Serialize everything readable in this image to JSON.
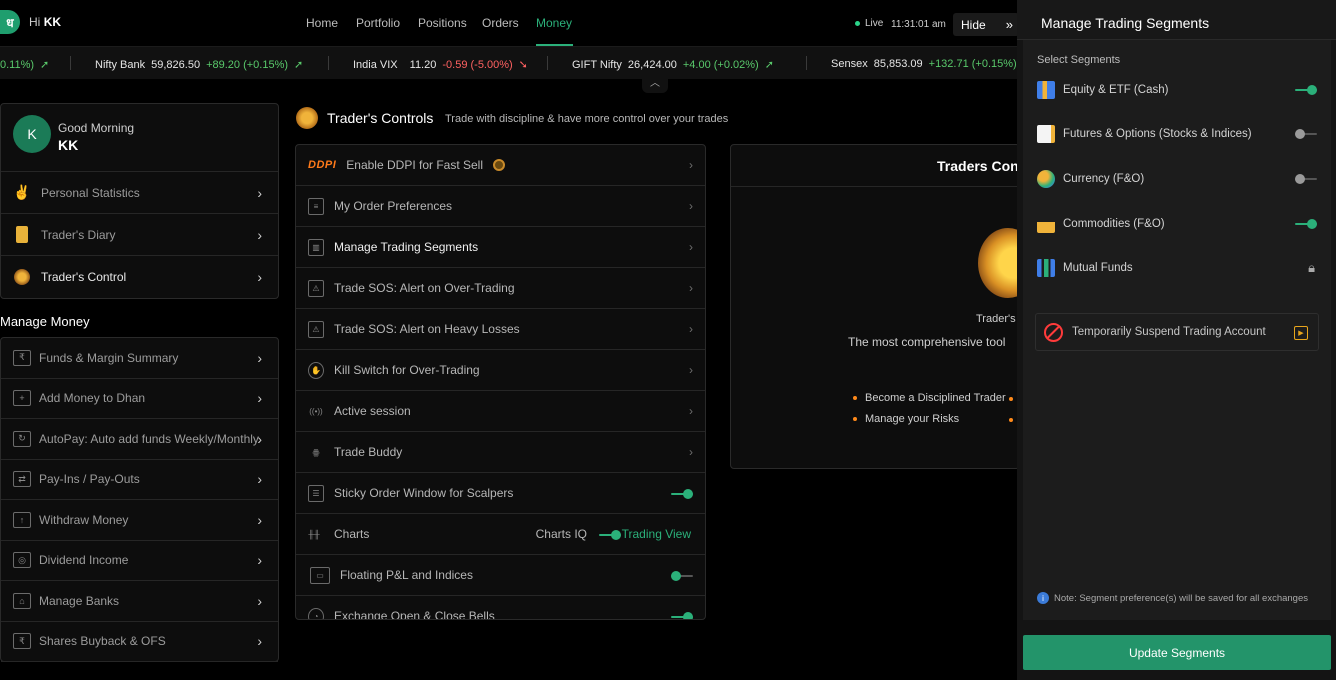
{
  "header": {
    "logo": "ध",
    "greeting": "Hi",
    "user_initials": "KK",
    "nav": [
      "Home",
      "Portfolio",
      "Positions",
      "Orders",
      "Money"
    ],
    "active_nav": "Money",
    "live": "Live",
    "time": "11:31:01 am",
    "hide": "Hide"
  },
  "ticker": [
    {
      "name": "",
      "price": "",
      "change": "0.11%)",
      "dir": "up"
    },
    {
      "name": "Nifty Bank",
      "price": "59,826.50",
      "change": "+89.20 (+0.15%)",
      "dir": "up"
    },
    {
      "name": "India VIX",
      "price": "11.20",
      "change": "-0.59 (-5.00%)",
      "dir": "down"
    },
    {
      "name": "GIFT Nifty",
      "price": "26,424.00",
      "change": "+4.00 (+0.02%)",
      "dir": "up"
    },
    {
      "name": "Sensex",
      "price": "85,853.09",
      "change": "+132.71 (+0.15%)",
      "dir": "up"
    }
  ],
  "profile": {
    "avatar_letter": "K",
    "greeting": "Good Morning",
    "name": "KK",
    "items": [
      "Personal Statistics",
      "Trader's Diary",
      "Trader's Control"
    ]
  },
  "manage_money": {
    "title": "Manage Money",
    "items": [
      "Funds & Margin Summary",
      "Add Money to Dhan",
      "AutoPay: Auto add funds Weekly/Monthly",
      "Pay-Ins / Pay-Outs",
      "Withdraw Money",
      "Dividend Income",
      "Manage Banks",
      "Shares Buyback & OFS"
    ]
  },
  "traders_controls": {
    "title": "Trader's Controls",
    "subtitle": "Trade with discipline & have more control over your trades",
    "ddpi_logo": "DDPI",
    "rows": [
      "Enable DDPI for Fast Sell",
      "My Order Preferences",
      "Manage Trading Segments",
      "Trade SOS: Alert on Over-Trading",
      "Trade SOS: Alert on Heavy Losses",
      "Kill Switch for Over-Trading",
      "Active session",
      "Trade Buddy",
      "Sticky Order Window for Scalpers",
      "Charts",
      "Floating P&L and Indices",
      "Exchange Open & Close Bells"
    ],
    "charts_iq": "Charts IQ",
    "trading_view": "Trading View"
  },
  "info_panel": {
    "title": "Traders Cont",
    "line1": "Trader's",
    "line2": "The most comprehensive tool",
    "bullets": [
      "Become a Disciplined Trader",
      "Manage your Risks"
    ]
  },
  "segments_panel": {
    "title": "Manage Trading Segments",
    "select_label": "Select Segments",
    "segments": [
      {
        "label": "Equity & ETF (Cash)",
        "enabled": true
      },
      {
        "label": "Futures & Options (Stocks & Indices)",
        "enabled": false
      },
      {
        "label": "Currency (F&O)",
        "enabled": false
      },
      {
        "label": "Commodities (F&O)",
        "enabled": true
      },
      {
        "label": "Mutual Funds",
        "locked": true
      }
    ],
    "suspend_label": "Temporarily Suspend Trading Account",
    "note": "Note: Segment preference(s) will be saved for all exchanges",
    "update_button": "Update Segments"
  },
  "colors": {
    "accent": "#2bb07a",
    "up": "#59c96b",
    "down": "#ff6161",
    "ddpi": "#ff7a1a"
  }
}
